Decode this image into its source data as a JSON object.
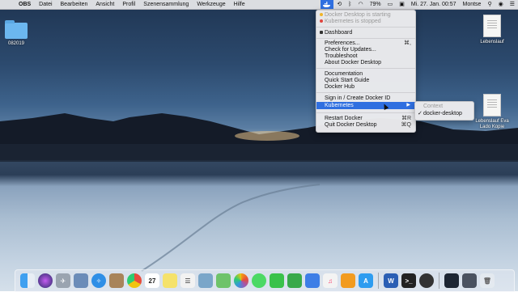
{
  "menubar": {
    "app_name": "OBS",
    "menus": [
      "Datei",
      "Bearbeiten",
      "Ansicht",
      "Profil",
      "Szenensammlung",
      "Werkzeuge",
      "Hilfe"
    ],
    "battery": "79%",
    "datetime": "Mi. 27. Jan.  00:57",
    "user": "Montse"
  },
  "desktop": {
    "folder_label": "082019",
    "file1_label": "Lebenslauf",
    "file2_label": "Lebenslauf Eva Lado Kopie"
  },
  "docker_menu": {
    "status_starting": "Docker Desktop is starting",
    "status_stopped": "Kubernetes is stopped",
    "dashboard": "Dashboard",
    "preferences": "Preferences...",
    "preferences_shortcut": "⌘,",
    "check_updates": "Check for Updates...",
    "troubleshoot": "Troubleshoot",
    "about": "About Docker Desktop",
    "documentation": "Documentation",
    "quick_start": "Quick Start Guide",
    "docker_hub": "Docker Hub",
    "sign_in": "Sign in / Create Docker ID",
    "kubernetes": "Kubernetes",
    "restart": "Restart Docker",
    "restart_shortcut": "⌘R",
    "quit": "Quit Docker Desktop",
    "quit_shortcut": "⌘Q",
    "status_colors": {
      "starting": "#f0b429",
      "stopped": "#e0443e"
    }
  },
  "kubernetes_submenu": {
    "header": "Context",
    "context": "docker-desktop"
  },
  "dock": {
    "apps": [
      "finder",
      "siri",
      "launchpad",
      "preview",
      "safari",
      "notes-brown",
      "chrome",
      "calendar",
      "stickies",
      "reminders",
      "photos-viewer",
      "maps",
      "photos",
      "messages",
      "facetime",
      "numbers",
      "keynote",
      "music",
      "books",
      "app-store",
      "word",
      "terminal",
      "obs",
      "screen",
      "trash"
    ],
    "calendar_day": "27"
  }
}
